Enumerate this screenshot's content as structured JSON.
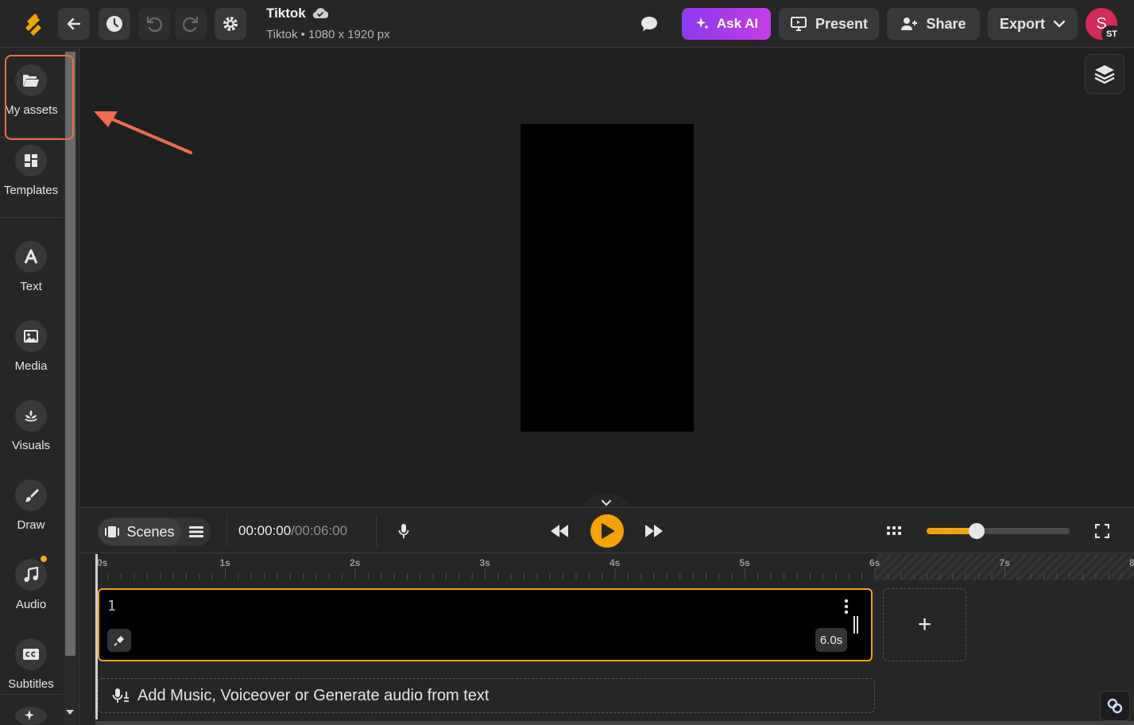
{
  "header": {
    "doc_title": "Tiktok",
    "doc_subtitle": "Tiktok • 1080 x 1920 px",
    "ask_ai_label": "Ask AI",
    "present_label": "Present",
    "share_label": "Share",
    "export_label": "Export",
    "avatar_initial": "S",
    "avatar_badge": "ST"
  },
  "sidebar": {
    "items": [
      {
        "label": "My assets",
        "icon": "folder-open-icon"
      },
      {
        "label": "Templates",
        "icon": "templates-icon"
      },
      {
        "label": "Text",
        "icon": "text-icon"
      },
      {
        "label": "Media",
        "icon": "image-icon"
      },
      {
        "label": "Visuals",
        "icon": "visuals-icon"
      },
      {
        "label": "Draw",
        "icon": "brush-icon"
      },
      {
        "label": "Audio",
        "icon": "music-note-icon"
      },
      {
        "label": "Subtitles",
        "icon": "cc-icon"
      }
    ]
  },
  "player": {
    "scenes_label": "Scenes",
    "current_time": "00:00:00",
    "total_time": "/00:06:00",
    "zoom_level": 0.35
  },
  "timeline": {
    "ticks": [
      "0s",
      "1s",
      "2s",
      "3s",
      "4s",
      "5s",
      "6s",
      "7s",
      "8"
    ],
    "scene_number": "1",
    "scene_duration": "6.0s",
    "add_scene_label": "+",
    "audio_prompt": "Add Music, Voiceover or Generate audio from text"
  },
  "colors": {
    "accent": "#f5a300",
    "highlight": "#f26b4b",
    "ai_gradient_start": "#8b3cf0",
    "ai_gradient_end": "#c43ce6",
    "avatar": "#d9295a"
  }
}
